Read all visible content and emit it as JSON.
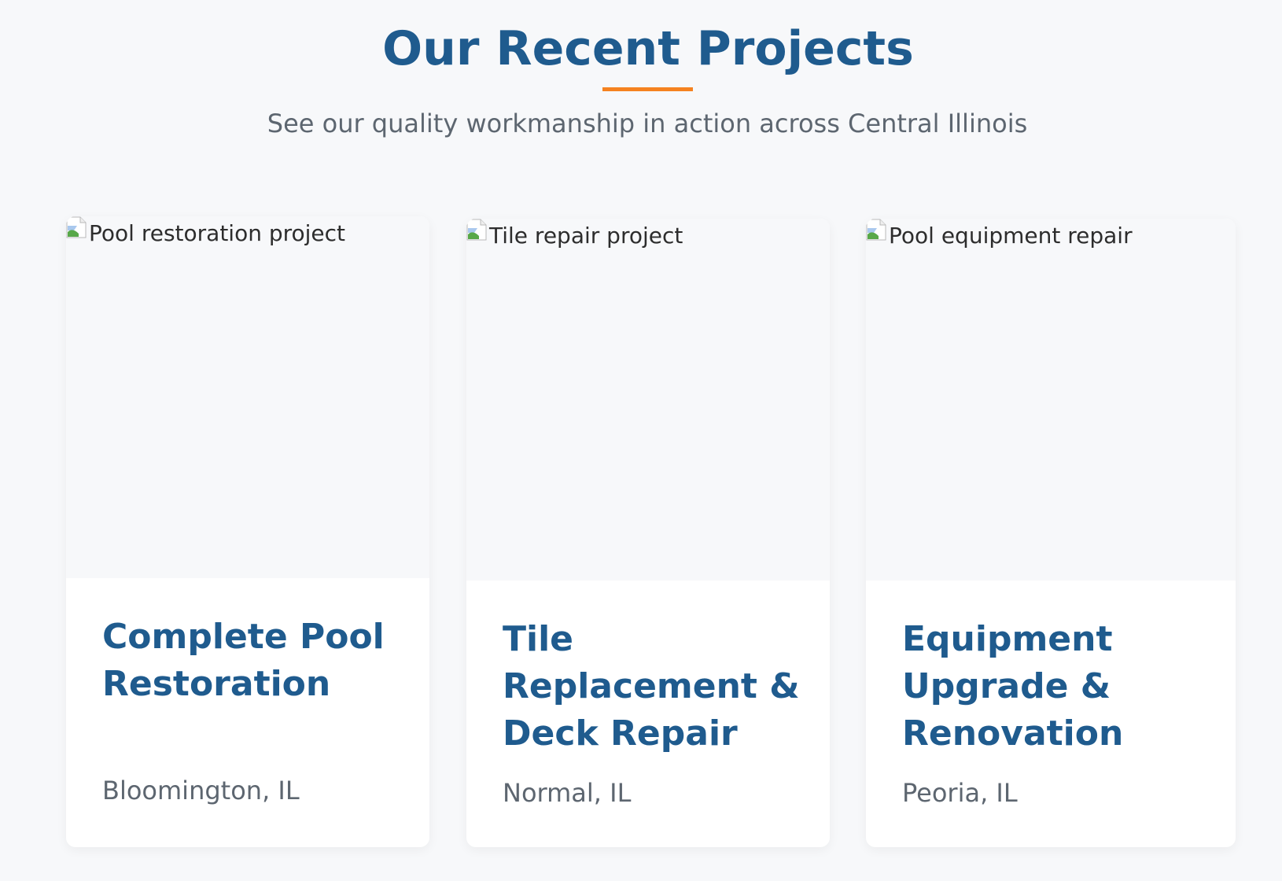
{
  "section": {
    "title": "Our Recent Projects",
    "subtitle": "See our quality workmanship in action across Central Illinois",
    "accent_color": "#f58220",
    "title_color": "#1f5b8e"
  },
  "projects": [
    {
      "image_alt": "Pool restoration project",
      "title": "Complete Pool Restoration",
      "location": "Bloomington, IL"
    },
    {
      "image_alt": "Tile repair project",
      "title": "Tile Replacement & Deck Repair",
      "location": "Normal, IL"
    },
    {
      "image_alt": "Pool equipment repair",
      "title": "Equipment Upgrade & Renovation",
      "location": "Peoria, IL"
    }
  ],
  "icons": {
    "broken_image": "broken-image-icon"
  }
}
